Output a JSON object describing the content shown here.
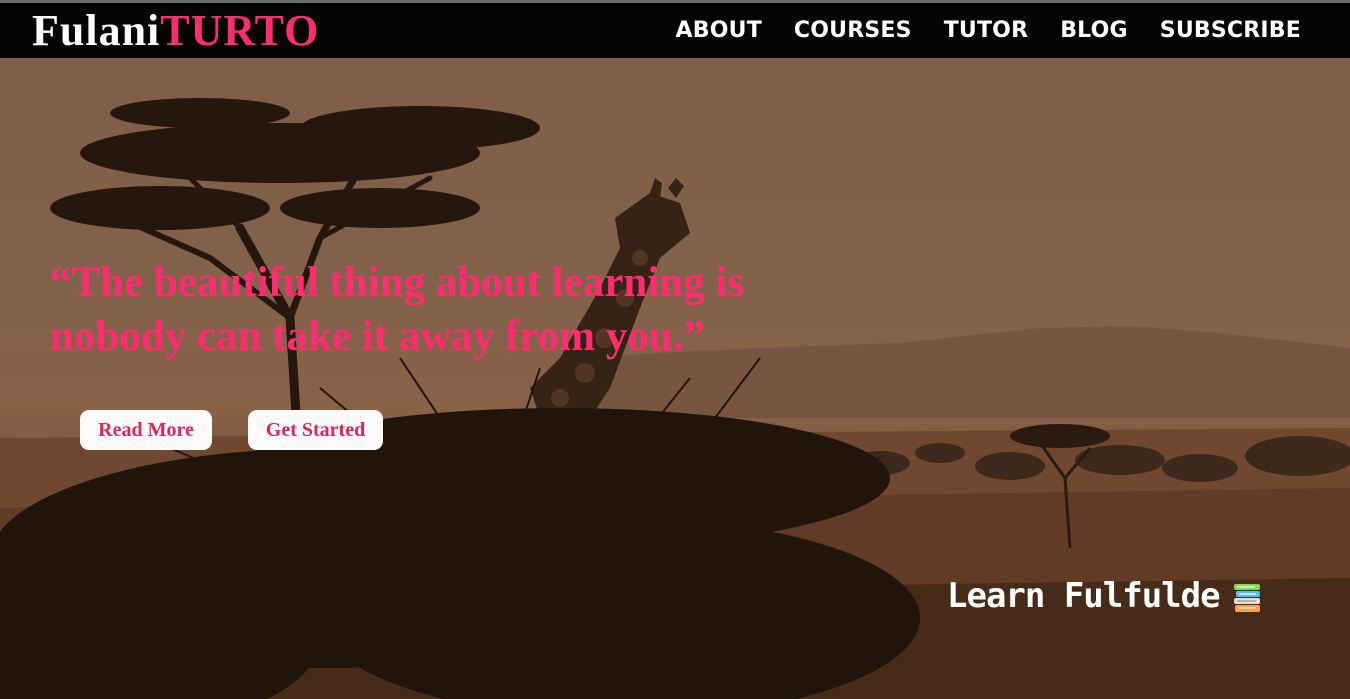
{
  "brand": {
    "first": "Fulani",
    "second": "TURTO"
  },
  "nav": {
    "items": [
      "ABOUT",
      "COURSES",
      "TUTOR",
      "BLOG",
      "SUBSCRIBE"
    ]
  },
  "hero": {
    "quote": "“The beautiful thing about learning is nobody can take it away from you.”",
    "buttons": {
      "read_more": "Read More",
      "get_started": "Get Started"
    },
    "tagline": "Learn Fulfulde",
    "tagline_icon": "books-icon"
  },
  "colors": {
    "accent": "#ff2d6f",
    "navbar_bg": "#050505",
    "button_bg": "#fffafa"
  }
}
